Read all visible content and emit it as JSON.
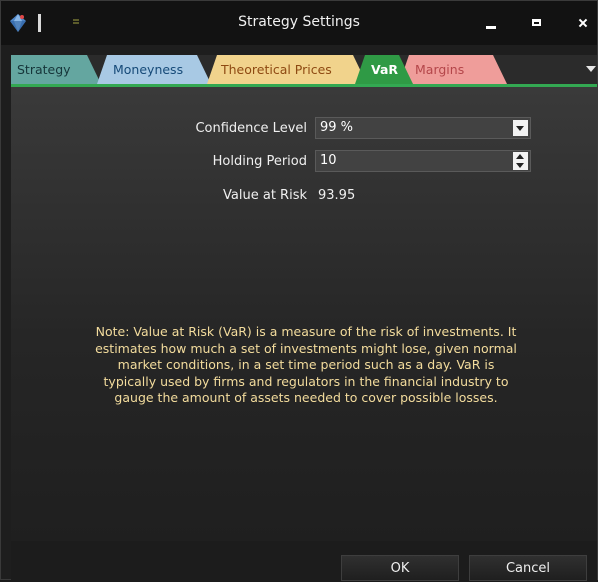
{
  "window": {
    "title": "Strategy Settings",
    "app_icon": "diamond-logo-icon",
    "controls": [
      "minimize-icon",
      "maximize-icon",
      "close-icon"
    ]
  },
  "tabs": [
    {
      "label": "Strategy",
      "color": "#64a6a0"
    },
    {
      "label": "Moneyness",
      "color": "#a8c9e4"
    },
    {
      "label": "Theoretical Prices",
      "color": "#f1d38c"
    },
    {
      "label": "VaR",
      "color": "#2f9a45",
      "active": true
    },
    {
      "label": "Margins",
      "color": "#ef9d9a"
    }
  ],
  "form": {
    "confidence_label": "Confidence Level",
    "confidence_value": "99 %",
    "holding_label": "Holding Period",
    "holding_value": "10",
    "var_label": "Value at Risk",
    "var_value": "93.95"
  },
  "note": "Note: Value at Risk (VaR) is a measure of the risk of investments. It estimates how much a set of investments might lose, given normal market conditions, in a set time period such as a day. VaR is typically used by firms and regulators in the financial industry to gauge the amount of assets needed to cover possible losses.",
  "buttons": {
    "ok": "OK",
    "cancel": "Cancel"
  },
  "colors": {
    "note_text": "#f3dc9d",
    "active_tab": "#2f9a45",
    "background": "#1e1e1e"
  }
}
